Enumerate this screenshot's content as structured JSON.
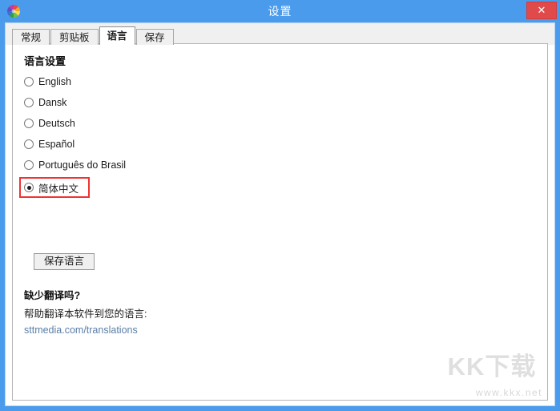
{
  "window": {
    "title": "设置",
    "app_icon": "color-wheel-icon",
    "close_label": "✕",
    "accent_color": "#4a9bec",
    "close_color": "#e04a4a"
  },
  "tabs": [
    {
      "label": "常规",
      "selected": false
    },
    {
      "label": "剪贴板",
      "selected": false
    },
    {
      "label": "语言",
      "selected": true
    },
    {
      "label": "保存",
      "selected": false
    }
  ],
  "language_panel": {
    "section_title": "语言设置",
    "options": [
      {
        "label": "English",
        "checked": false,
        "highlighted": false
      },
      {
        "label": "Dansk",
        "checked": false,
        "highlighted": false
      },
      {
        "label": "Deutsch",
        "checked": false,
        "highlighted": false
      },
      {
        "label": "Español",
        "checked": false,
        "highlighted": false
      },
      {
        "label": "Português do Brasil",
        "checked": false,
        "highlighted": false
      },
      {
        "label": "简体中文",
        "checked": true,
        "highlighted": true
      }
    ],
    "save_button": "保存语言",
    "highlight_color": "#ef3333"
  },
  "help": {
    "title": "缺少翻译吗?",
    "text": "帮助翻译本软件到您的语言:",
    "link": "sttmedia.com/translations",
    "link_color": "#5a7fa6"
  },
  "watermark": {
    "main": "KK下载",
    "sub": "www.kkx.net"
  }
}
